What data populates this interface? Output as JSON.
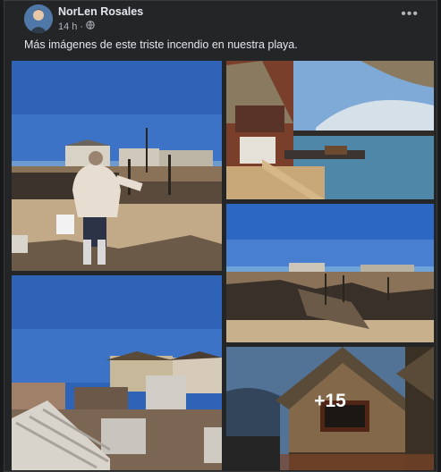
{
  "post": {
    "author": "NorLen Rosales",
    "time": "14 h",
    "dot": "·",
    "privacy_icon": "globe-icon",
    "menu_icon": "more-options-icon",
    "caption": "Más imágenes de este triste incendio en nuestra playa.",
    "more_photos_label": "+15"
  },
  "colors": {
    "background": "#18191a",
    "card": "#242526",
    "text_primary": "#e4e6eb",
    "text_secondary": "#b0b3b8"
  }
}
